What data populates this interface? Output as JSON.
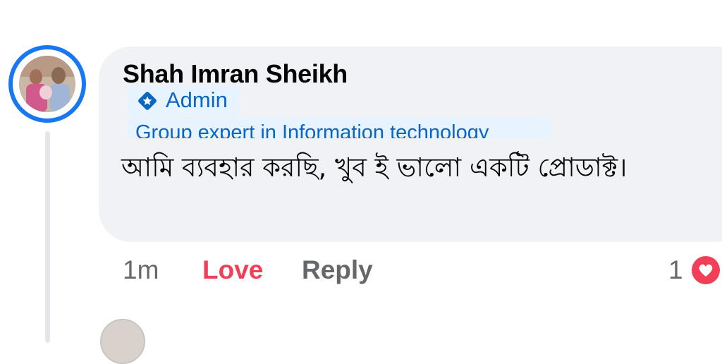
{
  "comment": {
    "author": "Shah Imran Sheikh",
    "badges": {
      "admin_label": "Admin",
      "expert_label": "Group expert in Information technology"
    },
    "text": "আমি ব্যবহার করছি, খুব ই ভালো একটি প্রোডাক্ট।",
    "actions": {
      "time": "1m",
      "love_label": "Love",
      "reply_label": "Reply",
      "reaction_count": "1"
    }
  },
  "icons": {
    "admin": "admin-shield-diamond-icon",
    "reaction": "love-reaction-icon"
  },
  "colors": {
    "accent": "#1877f2",
    "badge_text": "#0a66c2",
    "love": "#f33e58",
    "muted": "#65676b",
    "bubble": "#f0f2f5"
  }
}
